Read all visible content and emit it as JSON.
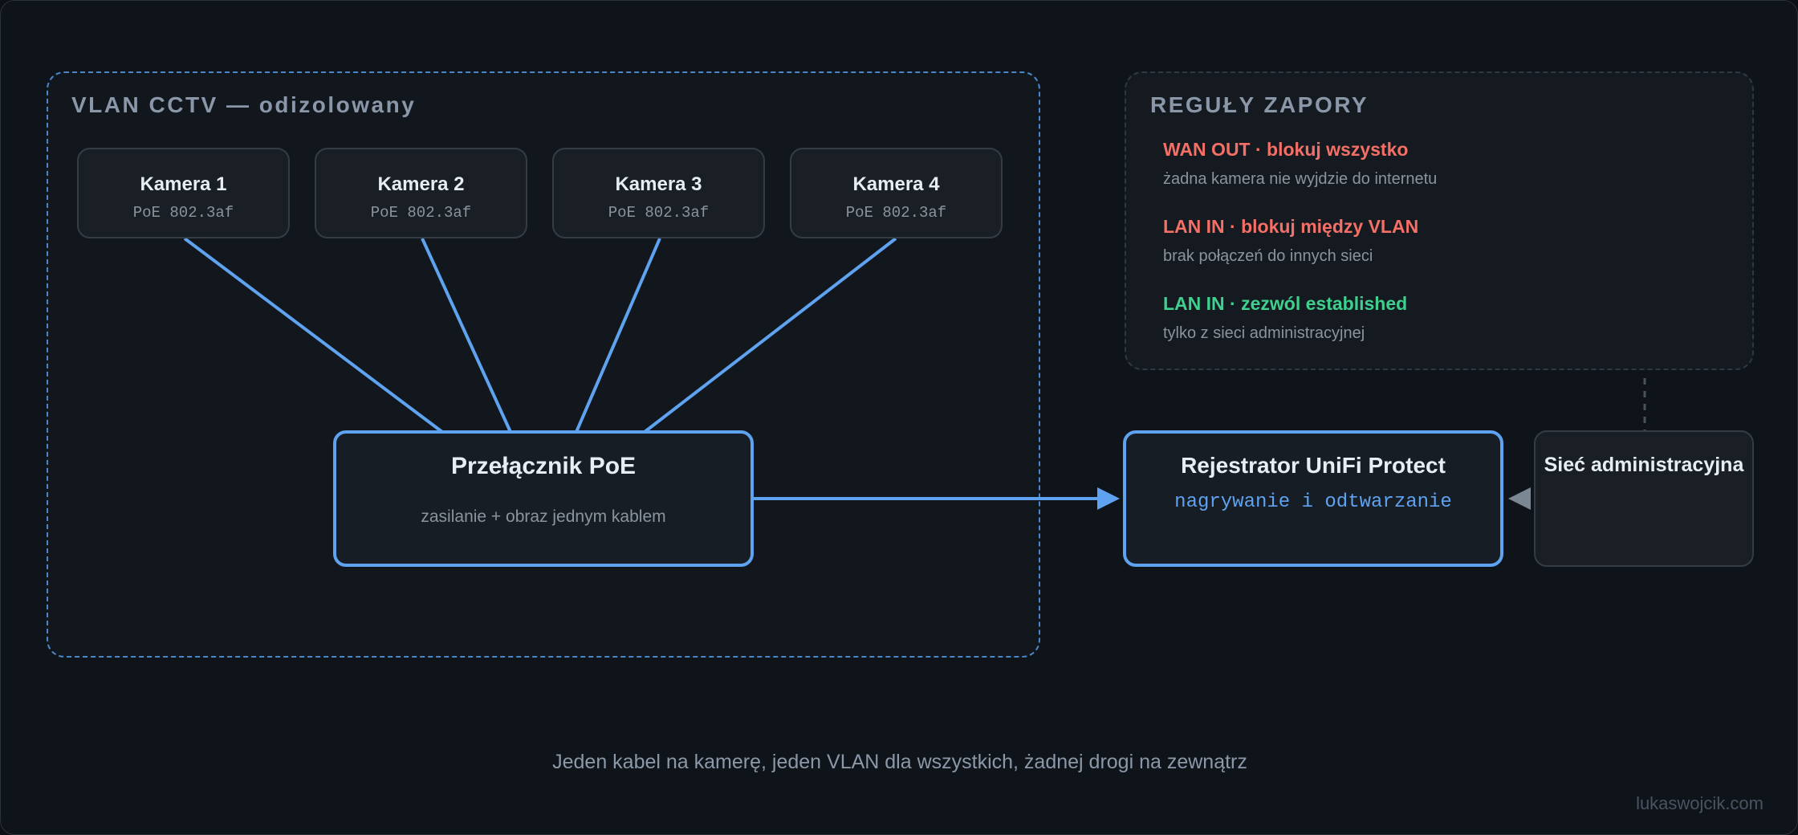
{
  "zones": {
    "vlan_title": "VLAN CCTV — odizolowany",
    "firewall_title": "REGUŁY ZAPORY"
  },
  "cameras": [
    {
      "name": "Kamera 1",
      "spec": "PoE 802.3af"
    },
    {
      "name": "Kamera 2",
      "spec": "PoE 802.3af"
    },
    {
      "name": "Kamera 3",
      "spec": "PoE 802.3af"
    },
    {
      "name": "Kamera 4",
      "spec": "PoE 802.3af"
    }
  ],
  "switch": {
    "title": "Przełącznik PoE",
    "subtitle": "zasilanie + obraz jednym kablem"
  },
  "recorder": {
    "title": "Rejestrator UniFi Protect",
    "subtitle": "nagrywanie i odtwarzanie"
  },
  "admin": {
    "title": "Sieć administracyjna"
  },
  "firewall_rules": [
    {
      "title": "WAN OUT · blokuj wszystko",
      "description": "żadna kamera nie wyjdzie do internetu",
      "color": "#f47067"
    },
    {
      "title": "LAN IN · blokuj między VLAN",
      "description": "brak połączeń do innych sieci",
      "color": "#f47067"
    },
    {
      "title": "LAN IN · zezwól established",
      "description": "tylko z sieci administracyjnej",
      "color": "#3fcf8e"
    }
  ],
  "caption": "Jeden kabel na kamerę, jeden VLAN dla wszystkich, żadnej drogi na zewnątrz",
  "watermark": "lukaswojcik.com",
  "colors": {
    "accent": "#5ea2f0",
    "background": "#0f141a",
    "card": "#1a1f25",
    "deny": "#f47067",
    "allow": "#3fcf8e"
  }
}
